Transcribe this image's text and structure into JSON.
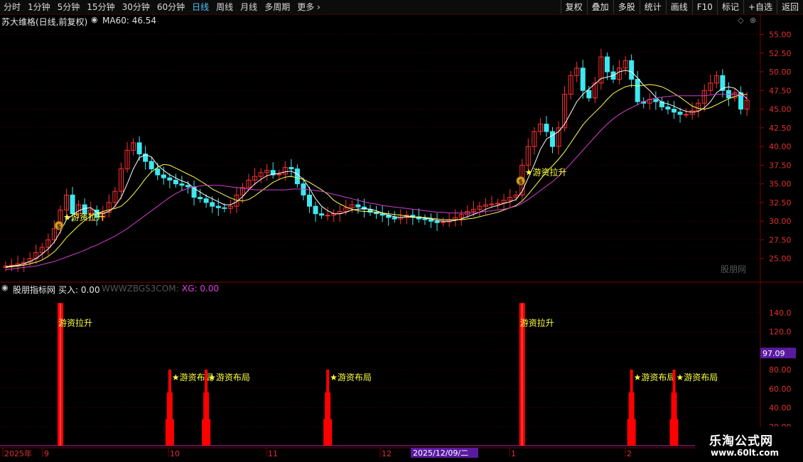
{
  "toolbar": {
    "periods": [
      "分时",
      "1分钟",
      "5分钟",
      "15分钟",
      "30分钟",
      "60分钟",
      "日线",
      "周线",
      "月线",
      "多周期",
      "更多"
    ],
    "active_period": "日线",
    "buttons": [
      "复权",
      "叠加",
      "多股",
      "统计",
      "画线",
      "F10",
      "标记",
      "+自选",
      "返回"
    ]
  },
  "main_panel": {
    "stock_title": "苏大维格(日线,前复权)",
    "ma_label": "MA60: 46.54",
    "watermark": "股朋网",
    "signal_label": "游资拉升"
  },
  "indicator_panel": {
    "name": "股朋指标网",
    "buy_label": "买入: 0.00",
    "site": "WWWZBGS3COM: -",
    "xg_label": "XG: 0.00",
    "current_value": "97.09",
    "label_lift": "游资拉升",
    "label_layout": "游资布局"
  },
  "date_axis": {
    "labels": [
      "2025年",
      "9",
      "10",
      "11",
      "12",
      "1",
      "2"
    ],
    "cursor_date": "2025/12/09/二"
  },
  "logo": {
    "line1": "乐淘公式网",
    "line2": "www.60lt.com"
  },
  "colors": {
    "up": "#ff3030",
    "down": "#3ee8f0",
    "ma5": "#ffffff",
    "ma10": "#ffff55",
    "ma60": "#d040d0",
    "signal": "#ff0000",
    "label": "#ffff40",
    "cursor_bg": "#5a1aa0"
  },
  "chart_data": [
    {
      "type": "candlestick",
      "title": "苏大维格(日线,前复权)",
      "y_ticks": [
        "55.00",
        "52.50",
        "50.00",
        "47.50",
        "45.00",
        "42.50",
        "40.00",
        "37.50",
        "35.00",
        "32.50",
        "30.00",
        "27.50",
        "25.00"
      ],
      "ylim": [
        22.5,
        56.0
      ],
      "series": [
        {
          "name": "price",
          "values": [
            24.0,
            24.1,
            24.3,
            24.5,
            25.0,
            25.8,
            26.5,
            27.5,
            29.0,
            31.5,
            33.5,
            31.0,
            32.2,
            31.0,
            31.5,
            30.5,
            31.2,
            32.5,
            34.0,
            37.0,
            39.5,
            40.5,
            39.0,
            38.0,
            37.0,
            36.2,
            35.8,
            35.5,
            35.0,
            34.8,
            34.6,
            33.2,
            33.0,
            32.5,
            32.0,
            31.8,
            31.7,
            32.0,
            33.5,
            34.5,
            35.5,
            36.0,
            36.5,
            36.8,
            36.2,
            36.3,
            37.2,
            37.0,
            35.0,
            33.5,
            32.0,
            31.0,
            30.8,
            30.8,
            31.0,
            31.3,
            31.8,
            32.2,
            31.9,
            31.6,
            31.2,
            31.0,
            30.8,
            30.5,
            30.3,
            30.5,
            30.8,
            30.6,
            30.3,
            30.2,
            30.0,
            29.8,
            29.9,
            30.2,
            30.5,
            30.9,
            31.3,
            31.6,
            32.0,
            32.2,
            32.3,
            32.4,
            32.8,
            33.2,
            33.5,
            37.5,
            40.0,
            42.0,
            43.0,
            42.0,
            40.0,
            42.5,
            47.0,
            49.5,
            50.5,
            47.5,
            46.5,
            48.5,
            52.0,
            50.0,
            49.0,
            50.5,
            51.5,
            49.0,
            46.0,
            45.8,
            46.3,
            46.0,
            45.3,
            45.0,
            44.6,
            44.3,
            44.3,
            44.8,
            45.8,
            47.5,
            48.5,
            49.5,
            47.5,
            46.5,
            47.2,
            45.0,
            46.2
          ]
        },
        {
          "name": "MA5",
          "values": [
            23.9,
            24.0,
            24.1,
            24.3,
            24.6,
            25.0,
            25.6,
            26.3,
            27.2,
            28.6,
            30.2,
            30.8,
            31.4,
            31.7,
            31.8,
            31.2,
            31.0,
            31.3,
            32.0,
            33.2,
            35.0,
            37.0,
            38.5,
            38.9,
            38.6,
            37.5,
            36.8,
            36.2,
            35.8,
            35.4,
            35.1,
            34.4,
            33.9,
            33.4,
            33.0,
            32.6,
            32.2,
            32.2,
            32.6,
            33.3,
            34.2,
            35.0,
            35.6,
            36.1,
            36.3,
            36.4,
            36.6,
            36.7,
            36.3,
            35.6,
            34.4,
            33.0,
            32.0,
            31.4,
            31.0,
            31.0,
            31.2,
            31.5,
            31.6,
            31.7,
            31.6,
            31.4,
            31.1,
            30.8,
            30.6,
            30.5,
            30.6,
            30.5,
            30.5,
            30.4,
            30.3,
            30.1,
            30.0,
            30.0,
            30.1,
            30.3,
            30.6,
            30.9,
            31.2,
            31.6,
            31.9,
            32.1,
            32.4,
            32.6,
            32.9,
            34.0,
            35.8,
            37.6,
            39.6,
            41.0,
            41.5,
            42.0,
            43.0,
            44.5,
            46.0,
            47.0,
            47.7,
            48.4,
            49.1,
            49.3,
            49.5,
            50.0,
            50.2,
            50.0,
            49.2,
            48.2,
            47.5,
            46.6,
            45.9,
            45.7,
            45.4,
            45.0,
            44.7,
            44.6,
            44.7,
            45.2,
            46.0,
            47.2,
            47.8,
            48.0,
            47.8,
            47.1,
            46.4
          ]
        },
        {
          "name": "MA10",
          "values": [
            23.8,
            23.9,
            24.0,
            24.1,
            24.3,
            24.5,
            24.8,
            25.3,
            25.9,
            26.8,
            27.8,
            28.6,
            29.4,
            30.1,
            30.7,
            31.0,
            31.3,
            31.5,
            31.7,
            32.0,
            32.7,
            33.6,
            34.6,
            35.7,
            36.6,
            37.2,
            37.6,
            37.5,
            37.1,
            36.7,
            36.3,
            35.9,
            35.4,
            34.9,
            34.3,
            33.9,
            33.5,
            33.1,
            32.8,
            32.7,
            32.9,
            33.4,
            34.0,
            34.6,
            35.2,
            35.6,
            35.9,
            36.0,
            35.8,
            35.6,
            35.2,
            34.7,
            34.2,
            33.6,
            32.8,
            32.3,
            31.9,
            31.6,
            31.4,
            31.3,
            31.3,
            31.2,
            31.1,
            31.0,
            30.9,
            30.8,
            30.7,
            30.6,
            30.5,
            30.5,
            30.4,
            30.3,
            30.2,
            30.2,
            30.2,
            30.2,
            30.3,
            30.4,
            30.6,
            30.8,
            31.0,
            31.2,
            31.5,
            31.8,
            32.1,
            32.7,
            33.6,
            34.6,
            35.6,
            36.6,
            37.4,
            38.3,
            39.3,
            40.5,
            41.7,
            42.9,
            43.8,
            44.6,
            45.4,
            46.3,
            47.1,
            47.6,
            48.0,
            48.2,
            48.1,
            48.2,
            48.3,
            48.2,
            48.0,
            47.6,
            47.1,
            46.6,
            46.0,
            45.4,
            45.1,
            45.0,
            45.2,
            45.6,
            46.0,
            46.4,
            46.7,
            46.9,
            47.0
          ]
        },
        {
          "name": "MA60",
          "values": [
            23.5,
            23.6,
            23.7,
            23.8,
            23.9,
            24.0,
            24.2,
            24.4,
            24.6,
            24.9,
            25.2,
            25.5,
            25.8,
            26.1,
            26.5,
            26.8,
            27.2,
            27.6,
            28.0,
            28.5,
            29.0,
            29.6,
            30.2,
            30.8,
            31.4,
            32.0,
            32.6,
            33.2,
            33.7,
            34.1,
            34.4,
            34.6,
            34.7,
            34.8,
            34.8,
            34.8,
            34.7,
            34.6,
            34.5,
            34.4,
            34.3,
            34.2,
            34.2,
            34.2,
            34.2,
            34.2,
            34.2,
            34.3,
            34.3,
            34.3,
            34.2,
            34.1,
            34.0,
            33.8,
            33.6,
            33.4,
            33.2,
            33.0,
            32.8,
            32.6,
            32.4,
            32.3,
            32.1,
            32.0,
            31.9,
            31.8,
            31.7,
            31.6,
            31.5,
            31.4,
            31.3,
            31.2,
            31.2,
            31.1,
            31.1,
            31.1,
            31.1,
            31.1,
            31.2,
            31.3,
            31.4,
            31.5,
            31.6,
            31.8,
            32.0,
            32.4,
            32.9,
            33.5,
            34.1,
            34.7,
            35.3,
            36.0,
            36.8,
            37.7,
            38.6,
            39.5,
            40.4,
            41.3,
            42.2,
            43.0,
            43.7,
            44.3,
            44.8,
            45.2,
            45.6,
            46.0,
            46.3,
            46.5,
            46.6,
            46.7,
            46.8,
            46.8,
            46.8,
            46.8,
            46.8,
            46.8,
            46.9,
            47.0,
            47.0,
            47.0,
            47.0,
            46.9,
            46.54
          ]
        }
      ],
      "signals": [
        {
          "label": "游资拉升",
          "index": 9
        },
        {
          "label": "游资拉升",
          "index": 85
        }
      ]
    },
    {
      "type": "bar",
      "title": "股朋指标网",
      "y_ticks": [
        "140.0",
        "120.0",
        "100.0",
        "80.00",
        "60.00",
        "40.00",
        "20.00"
      ],
      "ylim": [
        0,
        160
      ],
      "series": [
        {
          "name": "游资拉升",
          "values": [
            150,
            150
          ],
          "indices": [
            9,
            85
          ]
        },
        {
          "name": "游资布局",
          "values": [
            80,
            80,
            80,
            80,
            80
          ],
          "indices": [
            27,
            33,
            53,
            103,
            110
          ]
        }
      ]
    }
  ]
}
